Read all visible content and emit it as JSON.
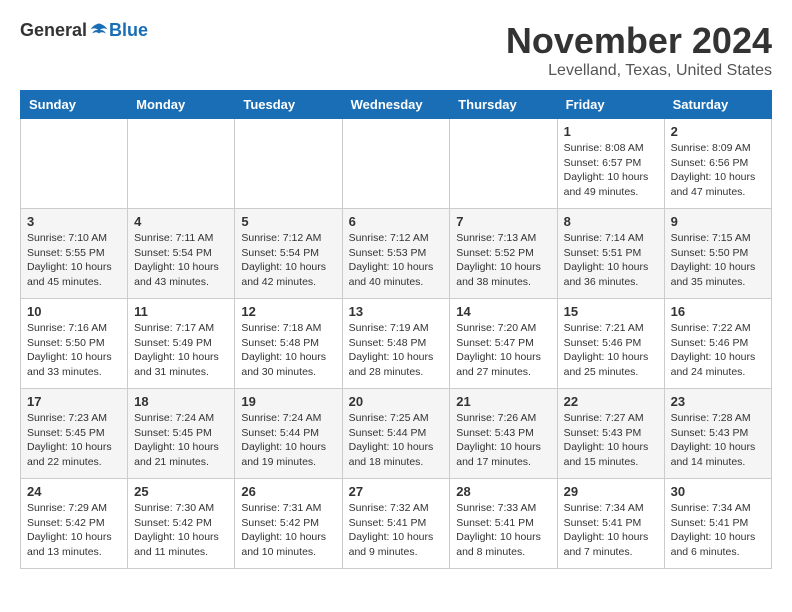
{
  "header": {
    "logo_general": "General",
    "logo_blue": "Blue",
    "month": "November 2024",
    "location": "Levelland, Texas, United States"
  },
  "weekdays": [
    "Sunday",
    "Monday",
    "Tuesday",
    "Wednesday",
    "Thursday",
    "Friday",
    "Saturday"
  ],
  "weeks": [
    [
      {
        "day": "",
        "info": ""
      },
      {
        "day": "",
        "info": ""
      },
      {
        "day": "",
        "info": ""
      },
      {
        "day": "",
        "info": ""
      },
      {
        "day": "",
        "info": ""
      },
      {
        "day": "1",
        "info": "Sunrise: 8:08 AM\nSunset: 6:57 PM\nDaylight: 10 hours and 49 minutes."
      },
      {
        "day": "2",
        "info": "Sunrise: 8:09 AM\nSunset: 6:56 PM\nDaylight: 10 hours and 47 minutes."
      }
    ],
    [
      {
        "day": "3",
        "info": "Sunrise: 7:10 AM\nSunset: 5:55 PM\nDaylight: 10 hours and 45 minutes."
      },
      {
        "day": "4",
        "info": "Sunrise: 7:11 AM\nSunset: 5:54 PM\nDaylight: 10 hours and 43 minutes."
      },
      {
        "day": "5",
        "info": "Sunrise: 7:12 AM\nSunset: 5:54 PM\nDaylight: 10 hours and 42 minutes."
      },
      {
        "day": "6",
        "info": "Sunrise: 7:12 AM\nSunset: 5:53 PM\nDaylight: 10 hours and 40 minutes."
      },
      {
        "day": "7",
        "info": "Sunrise: 7:13 AM\nSunset: 5:52 PM\nDaylight: 10 hours and 38 minutes."
      },
      {
        "day": "8",
        "info": "Sunrise: 7:14 AM\nSunset: 5:51 PM\nDaylight: 10 hours and 36 minutes."
      },
      {
        "day": "9",
        "info": "Sunrise: 7:15 AM\nSunset: 5:50 PM\nDaylight: 10 hours and 35 minutes."
      }
    ],
    [
      {
        "day": "10",
        "info": "Sunrise: 7:16 AM\nSunset: 5:50 PM\nDaylight: 10 hours and 33 minutes."
      },
      {
        "day": "11",
        "info": "Sunrise: 7:17 AM\nSunset: 5:49 PM\nDaylight: 10 hours and 31 minutes."
      },
      {
        "day": "12",
        "info": "Sunrise: 7:18 AM\nSunset: 5:48 PM\nDaylight: 10 hours and 30 minutes."
      },
      {
        "day": "13",
        "info": "Sunrise: 7:19 AM\nSunset: 5:48 PM\nDaylight: 10 hours and 28 minutes."
      },
      {
        "day": "14",
        "info": "Sunrise: 7:20 AM\nSunset: 5:47 PM\nDaylight: 10 hours and 27 minutes."
      },
      {
        "day": "15",
        "info": "Sunrise: 7:21 AM\nSunset: 5:46 PM\nDaylight: 10 hours and 25 minutes."
      },
      {
        "day": "16",
        "info": "Sunrise: 7:22 AM\nSunset: 5:46 PM\nDaylight: 10 hours and 24 minutes."
      }
    ],
    [
      {
        "day": "17",
        "info": "Sunrise: 7:23 AM\nSunset: 5:45 PM\nDaylight: 10 hours and 22 minutes."
      },
      {
        "day": "18",
        "info": "Sunrise: 7:24 AM\nSunset: 5:45 PM\nDaylight: 10 hours and 21 minutes."
      },
      {
        "day": "19",
        "info": "Sunrise: 7:24 AM\nSunset: 5:44 PM\nDaylight: 10 hours and 19 minutes."
      },
      {
        "day": "20",
        "info": "Sunrise: 7:25 AM\nSunset: 5:44 PM\nDaylight: 10 hours and 18 minutes."
      },
      {
        "day": "21",
        "info": "Sunrise: 7:26 AM\nSunset: 5:43 PM\nDaylight: 10 hours and 17 minutes."
      },
      {
        "day": "22",
        "info": "Sunrise: 7:27 AM\nSunset: 5:43 PM\nDaylight: 10 hours and 15 minutes."
      },
      {
        "day": "23",
        "info": "Sunrise: 7:28 AM\nSunset: 5:43 PM\nDaylight: 10 hours and 14 minutes."
      }
    ],
    [
      {
        "day": "24",
        "info": "Sunrise: 7:29 AM\nSunset: 5:42 PM\nDaylight: 10 hours and 13 minutes."
      },
      {
        "day": "25",
        "info": "Sunrise: 7:30 AM\nSunset: 5:42 PM\nDaylight: 10 hours and 11 minutes."
      },
      {
        "day": "26",
        "info": "Sunrise: 7:31 AM\nSunset: 5:42 PM\nDaylight: 10 hours and 10 minutes."
      },
      {
        "day": "27",
        "info": "Sunrise: 7:32 AM\nSunset: 5:41 PM\nDaylight: 10 hours and 9 minutes."
      },
      {
        "day": "28",
        "info": "Sunrise: 7:33 AM\nSunset: 5:41 PM\nDaylight: 10 hours and 8 minutes."
      },
      {
        "day": "29",
        "info": "Sunrise: 7:34 AM\nSunset: 5:41 PM\nDaylight: 10 hours and 7 minutes."
      },
      {
        "day": "30",
        "info": "Sunrise: 7:34 AM\nSunset: 5:41 PM\nDaylight: 10 hours and 6 minutes."
      }
    ]
  ]
}
